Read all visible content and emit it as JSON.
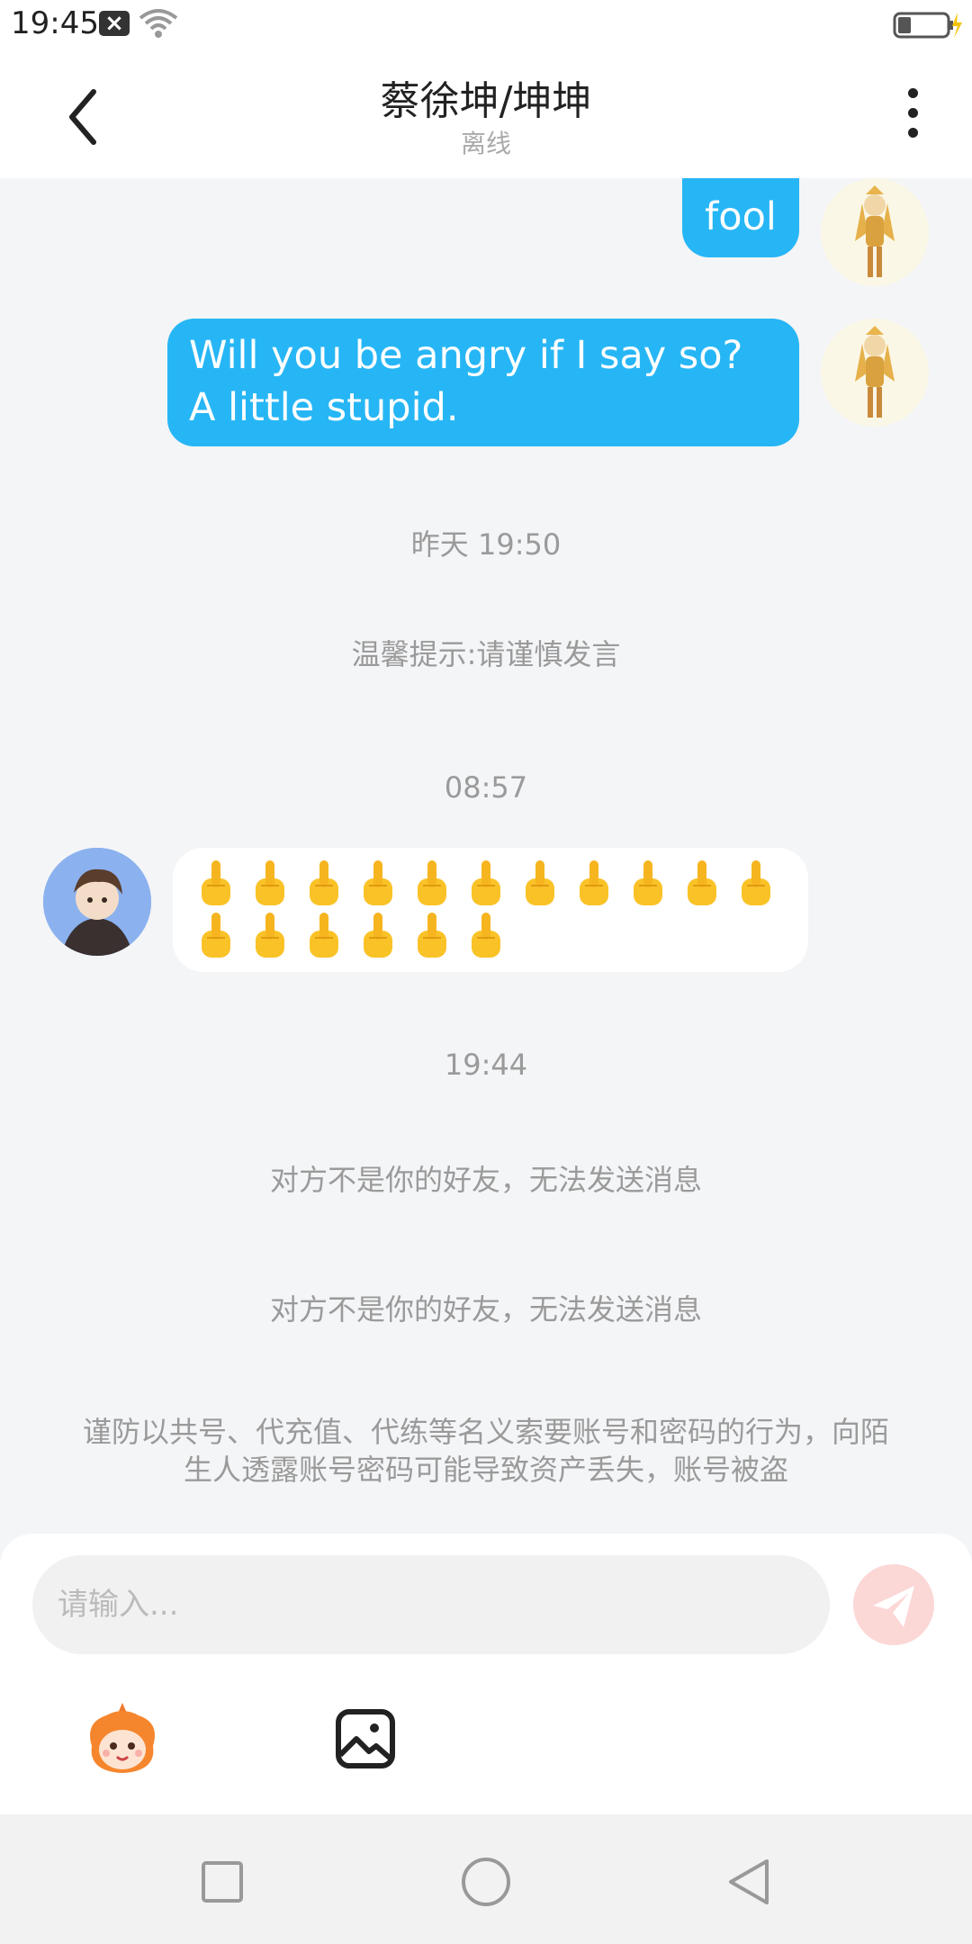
{
  "status_bar": {
    "time": "19:45",
    "notification_badge": "×"
  },
  "header": {
    "title": "蔡徐坤/坤坤",
    "presence": "离线"
  },
  "messages": {
    "out_1": "fool",
    "out_2": "Will you be angry if I say so? A little stupid."
  },
  "system": {
    "time_1": "昨天 19:50",
    "tip": "温馨提示:请谨慎发言",
    "time_2": "08:57",
    "time_3": "19:44",
    "not_friend_1": "对方不是你的好友，无法发送消息",
    "not_friend_2": "对方不是你的好友，无法发送消息",
    "warning": "谨防以共号、代充值、代练等名义索要账号和密码的行为，向陌生人透露账号密码可能导致资产丢失，账号被盗"
  },
  "incoming_emoji": {
    "icon": "middle-finger-emoji",
    "count": 17
  },
  "composer": {
    "placeholder": "请输入..."
  },
  "colors": {
    "outgoing_bubble": "#27b6f5",
    "background": "#f4f5f7",
    "system_text": "#9a9a9a",
    "send_button": "#fbd7d6"
  }
}
